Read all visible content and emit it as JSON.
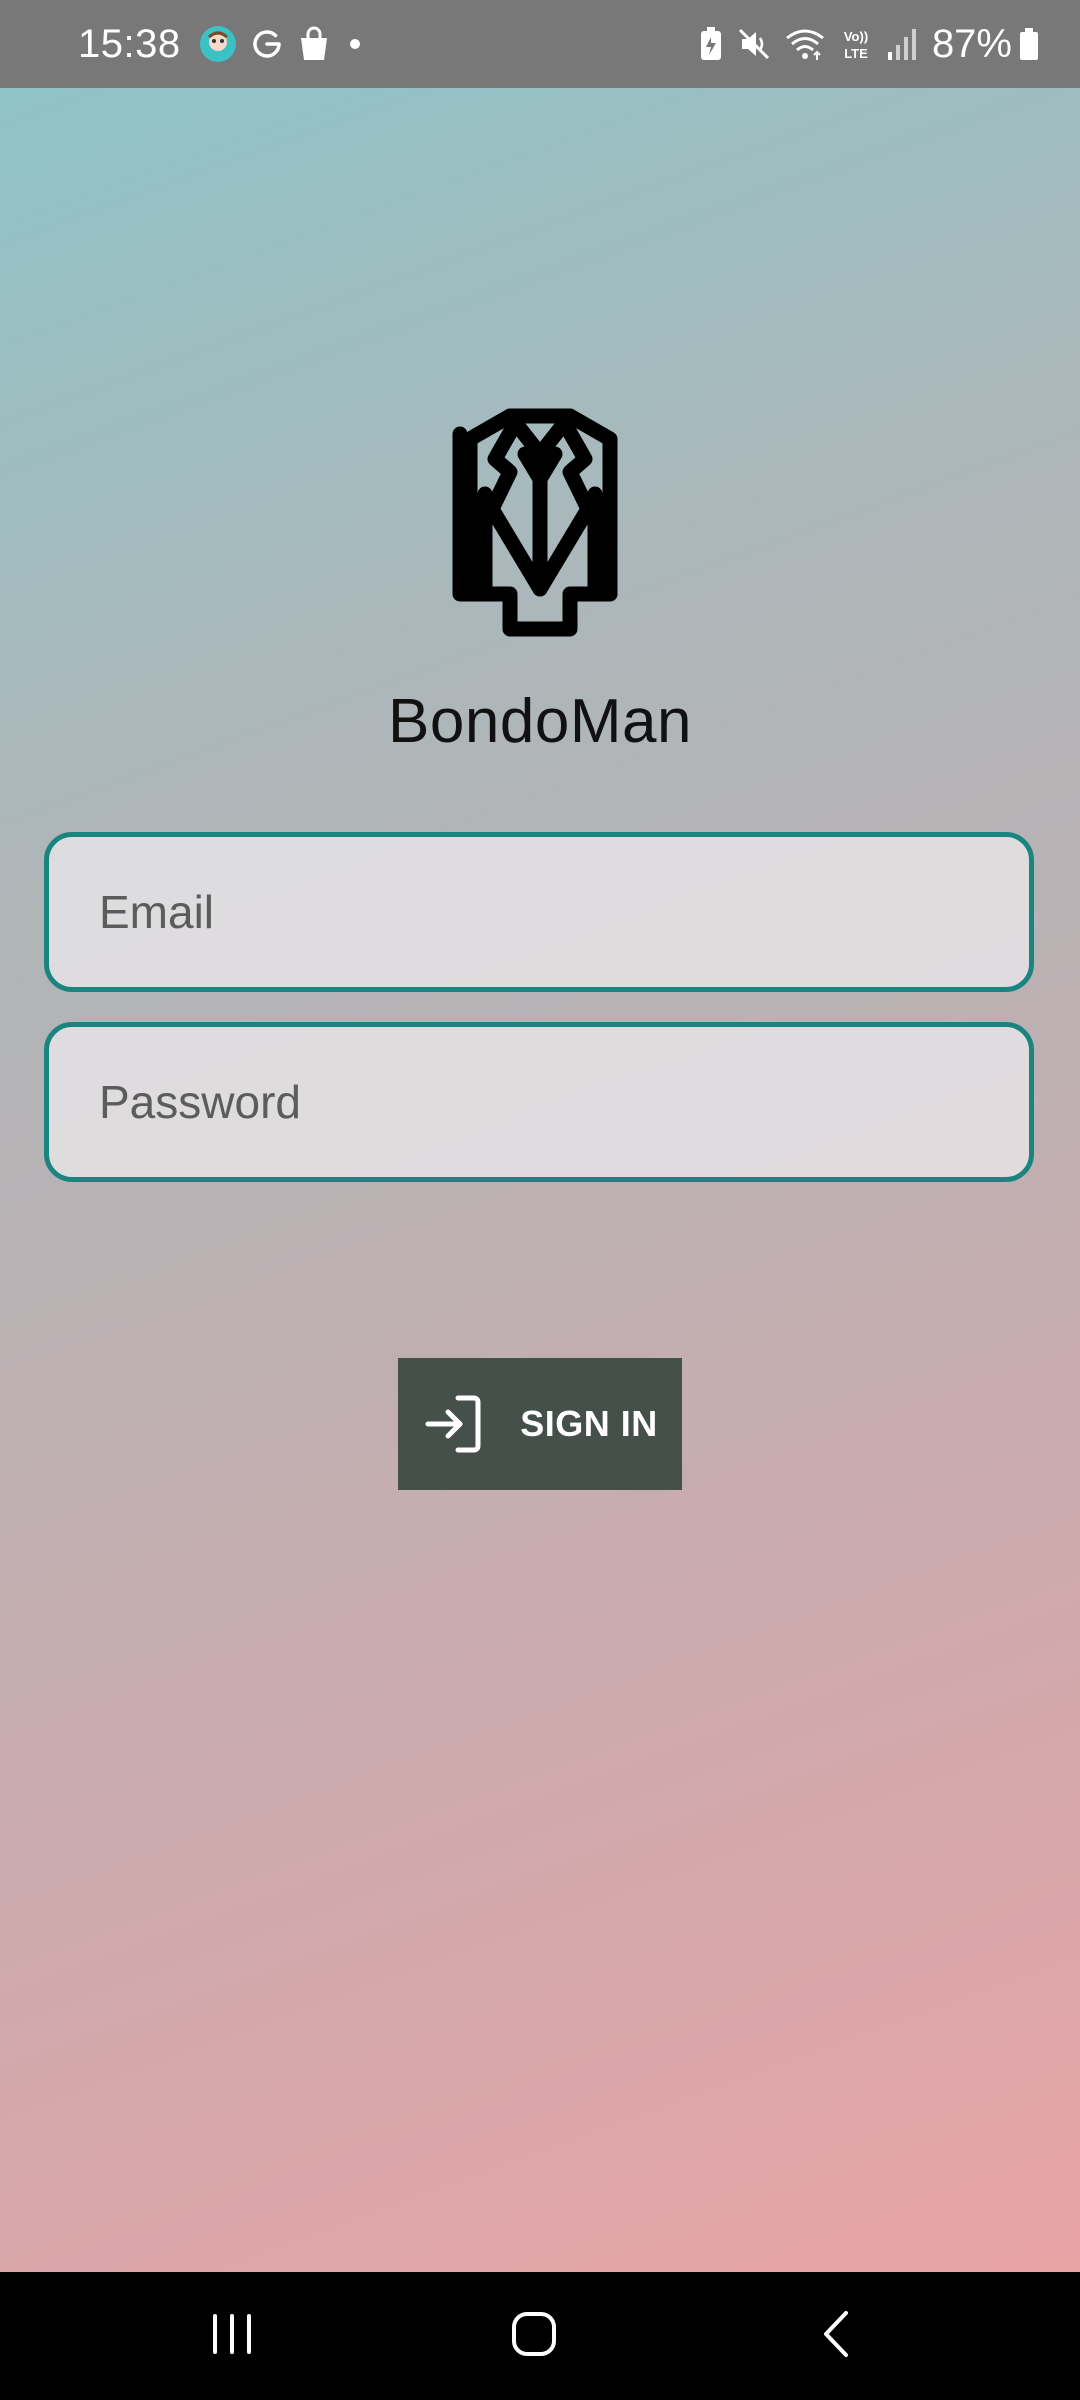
{
  "status_bar": {
    "time": "15:38",
    "battery_percent": "87%",
    "icons_left": [
      "app-notification-icon",
      "google-icon",
      "shopping-bag-icon",
      "dot-icon"
    ],
    "icons_right": [
      "battery-saver-icon",
      "mute-icon",
      "wifi-icon",
      "volte-icon",
      "signal-icon",
      "battery-icon"
    ]
  },
  "app": {
    "name": "BondoMan",
    "logo_icon": "suit-jacket-icon"
  },
  "login": {
    "email_placeholder": "Email",
    "email_value": "",
    "password_placeholder": "Password",
    "password_value": "",
    "signin_label": "SIGN IN",
    "signin_icon": "login-icon"
  },
  "nav_bar": {
    "buttons": [
      "recent-apps",
      "home",
      "back"
    ]
  },
  "colors": {
    "field_border": "#1a8580",
    "button_bg": "#445049",
    "status_bar_bg": "#787878",
    "gradient_top": "#8fc3c6",
    "gradient_bottom": "#e8a3a5"
  }
}
